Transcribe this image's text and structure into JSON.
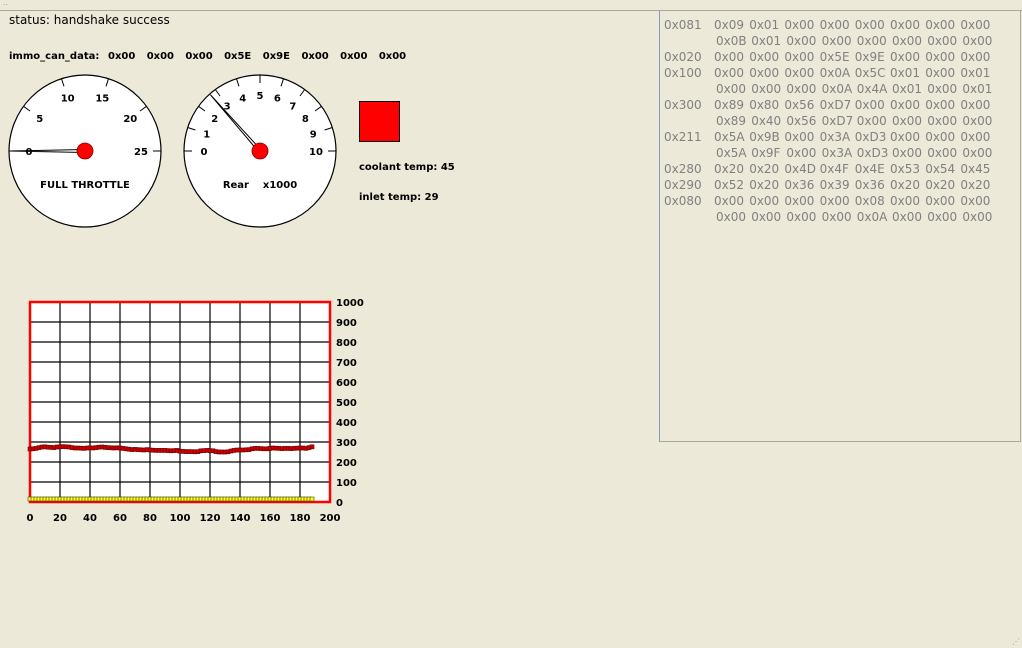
{
  "status": "status: handshake success",
  "immo": {
    "label": "immo_can_data:",
    "bytes": [
      "0x00",
      "0x00",
      "0x00",
      "0x5E",
      "0x9E",
      "0x00",
      "0x00",
      "0x00"
    ]
  },
  "gauge_throttle": {
    "label": "FULL THROTTLE",
    "ticks": [
      "0",
      "5",
      "10",
      "15",
      "20",
      "25"
    ],
    "min": 0,
    "max": 25,
    "value": 0
  },
  "gauge_rpm": {
    "label": "Rear    x1000",
    "ticks": [
      "0",
      "1",
      "2",
      "3",
      "4",
      "5",
      "6",
      "7",
      "8",
      "9",
      "10"
    ],
    "min": 0,
    "max": 10,
    "value": 2.7
  },
  "indicator": {
    "color": "#ff0000"
  },
  "coolant": "coolant temp: 45",
  "inlet": "inlet temp: 29",
  "can_rows": [
    {
      "id": "0x081",
      "bytes": [
        "0x09",
        "0x01",
        "0x00",
        "0x00",
        "0x00",
        "0x00",
        "0x00",
        "0x00"
      ]
    },
    {
      "id": "",
      "bytes": [
        "0x0B",
        "0x01",
        "0x00",
        "0x00",
        "0x00",
        "0x00",
        "0x00",
        "0x00"
      ]
    },
    {
      "id": "0x020",
      "bytes": [
        "0x00",
        "0x00",
        "0x00",
        "0x5E",
        "0x9E",
        "0x00",
        "0x00",
        "0x00"
      ]
    },
    {
      "id": "0x100",
      "bytes": [
        "0x00",
        "0x00",
        "0x00",
        "0x0A",
        "0x5C",
        "0x01",
        "0x00",
        "0x01"
      ]
    },
    {
      "id": "",
      "bytes": [
        "0x00",
        "0x00",
        "0x00",
        "0x0A",
        "0x4A",
        "0x01",
        "0x00",
        "0x01"
      ]
    },
    {
      "id": "0x300",
      "bytes": [
        "0x89",
        "0x80",
        "0x56",
        "0xD7",
        "0x00",
        "0x00",
        "0x00",
        "0x00"
      ]
    },
    {
      "id": "",
      "bytes": [
        "0x89",
        "0x40",
        "0x56",
        "0xD7",
        "0x00",
        "0x00",
        "0x00",
        "0x00"
      ]
    },
    {
      "id": "0x211",
      "bytes": [
        "0x5A",
        "0x9B",
        "0x00",
        "0x3A",
        "0xD3",
        "0x00",
        "0x00",
        "0x00"
      ]
    },
    {
      "id": "",
      "bytes": [
        "0x5A",
        "0x9F",
        "0x00",
        "0x3A",
        "0xD3",
        "0x00",
        "0x00",
        "0x00"
      ]
    },
    {
      "id": "0x280",
      "bytes": [
        "0x20",
        "0x20",
        "0x4D",
        "0x4F",
        "0x4E",
        "0x53",
        "0x54",
        "0x45"
      ]
    },
    {
      "id": "0x290",
      "bytes": [
        "0x52",
        "0x20",
        "0x36",
        "0x39",
        "0x36",
        "0x20",
        "0x20",
        "0x20"
      ]
    },
    {
      "id": "0x080",
      "bytes": [
        "0x00",
        "0x00",
        "0x00",
        "0x00",
        "0x08",
        "0x00",
        "0x00",
        "0x00"
      ]
    },
    {
      "id": "",
      "bytes": [
        "0x00",
        "0x00",
        "0x00",
        "0x00",
        "0x0A",
        "0x00",
        "0x00",
        "0x00"
      ]
    }
  ],
  "chart_data": {
    "type": "line",
    "xlim": [
      0,
      200
    ],
    "ylim": [
      0,
      1000
    ],
    "xticks": [
      "0",
      "20",
      "40",
      "60",
      "80",
      "100",
      "120",
      "140",
      "160",
      "180",
      "200"
    ],
    "yticks": [
      "0",
      "100",
      "200",
      "300",
      "400",
      "500",
      "600",
      "700",
      "800",
      "900",
      "1000"
    ],
    "grid": true,
    "colors": {
      "frame": "#ff0000",
      "series1": "#cc0000",
      "series2": "#ffff00"
    },
    "x_step": 2,
    "series": [
      {
        "values": [
          265,
          266,
          268,
          272,
          275,
          276,
          274,
          273,
          272,
          275,
          276,
          277,
          276,
          275,
          272,
          270,
          270,
          269,
          268,
          270,
          271,
          270,
          272,
          274,
          275,
          273,
          272,
          271,
          270,
          271,
          270,
          268,
          266,
          264,
          262,
          263,
          262,
          261,
          260,
          262,
          260,
          259,
          258,
          258,
          258,
          258,
          257,
          256,
          257,
          258,
          254,
          253,
          252,
          252,
          252,
          251,
          252,
          256,
          257,
          258,
          257,
          256,
          252,
          250,
          250,
          250,
          251,
          255,
          258,
          260,
          260,
          260,
          261,
          262,
          266,
          268,
          268,
          267,
          266,
          266,
          268,
          270,
          269,
          268,
          267,
          268,
          268,
          267,
          268,
          269,
          270,
          270,
          268,
          272,
          276
        ]
      },
      {
        "values": [
          15,
          15,
          15,
          15,
          15,
          15,
          15,
          15,
          15,
          15,
          15,
          15,
          15,
          15,
          15,
          15,
          15,
          15,
          15,
          15,
          15,
          15,
          15,
          15,
          15,
          15,
          15,
          15,
          15,
          15,
          15,
          15,
          15,
          15,
          15,
          15,
          15,
          15,
          15,
          15,
          15,
          15,
          15,
          15,
          15,
          15,
          15,
          15,
          15,
          15,
          15,
          15,
          15,
          15,
          15,
          15,
          15,
          15,
          15,
          15,
          15,
          15,
          15,
          15,
          15,
          15,
          15,
          15,
          15,
          15,
          15,
          15,
          15,
          15,
          15,
          15,
          15,
          15,
          15,
          15,
          15,
          15,
          15,
          15,
          15,
          15,
          15,
          15,
          15,
          15,
          15,
          15,
          15,
          15,
          15
        ]
      }
    ]
  }
}
